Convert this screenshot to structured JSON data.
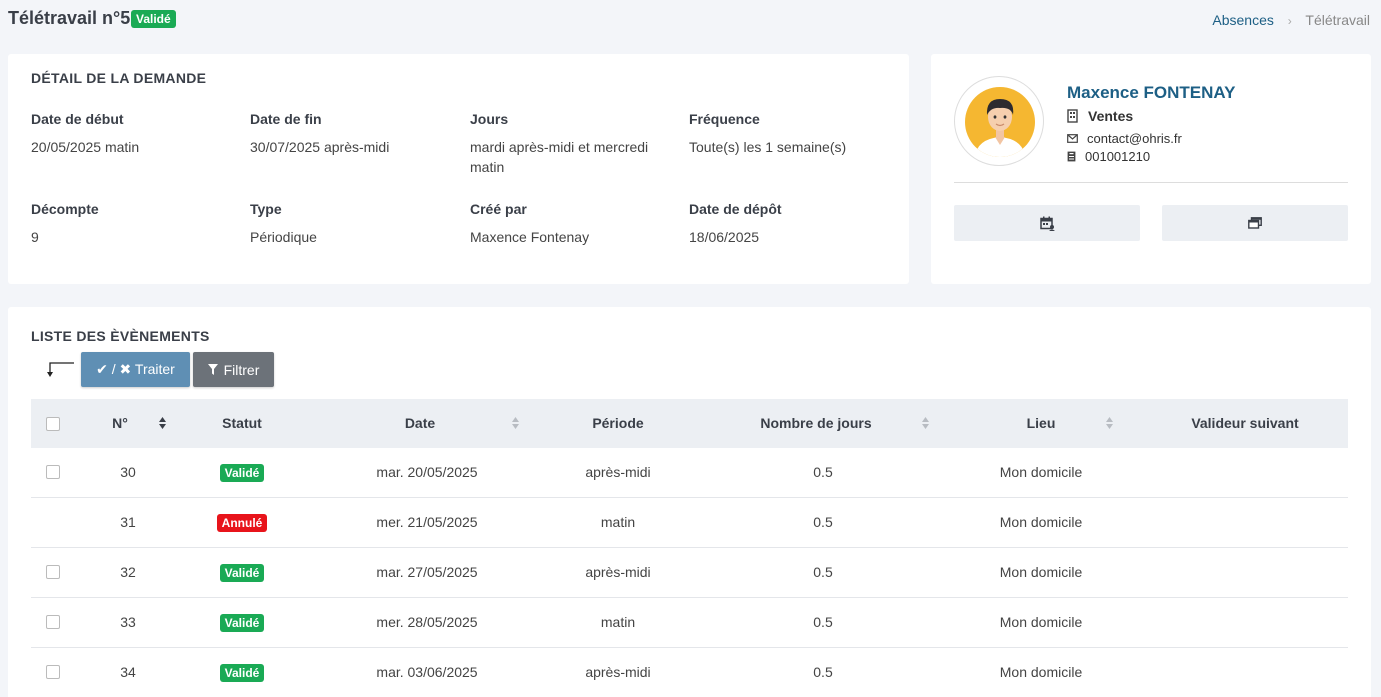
{
  "header": {
    "title": "Télétravail n°5",
    "status_badge": "Validé",
    "breadcrumb": {
      "parent": "Absences",
      "separator": "›",
      "current": "Télétravail"
    }
  },
  "detail": {
    "section_title": "DÉTAIL DE LA DEMANDE",
    "fields": [
      {
        "label": "Date de début",
        "value": "20/05/2025 matin"
      },
      {
        "label": "Date de fin",
        "value": "30/07/2025 après-midi"
      },
      {
        "label": "Jours",
        "value": "mardi après-midi et mercredi matin"
      },
      {
        "label": "Fréquence",
        "value": "Toute(s) les 1 semaine(s)"
      },
      {
        "label": "Décompte",
        "value": "9"
      },
      {
        "label": "Type",
        "value": "Périodique"
      },
      {
        "label": "Créé par",
        "value": "Maxence Fontenay"
      },
      {
        "label": "Date de dépôt",
        "value": "18/06/2025"
      }
    ]
  },
  "profile": {
    "name": "Maxence FONTENAY",
    "department": "Ventes",
    "email": "contact@ohris.fr",
    "employee_id": "001001210",
    "icons": {
      "department": "building-icon",
      "email": "envelope-icon",
      "id": "id-badge-icon",
      "btn1": "calendar-user-icon",
      "btn2": "windows-icon"
    }
  },
  "events": {
    "section_title": "LISTE DES ÈVÈNEMENTS",
    "actions": {
      "traiter_label": "✔ / ✖ Traiter",
      "filtrer_label": "Filtrer"
    },
    "columns": [
      "N°",
      "Statut",
      "Date",
      "Période",
      "Nombre de jours",
      "Lieu",
      "Valideur suivant"
    ],
    "rows": [
      {
        "num": "30",
        "status": "Validé",
        "status_color": "#1aaa55",
        "date": "mar. 20/05/2025",
        "period": "après-midi",
        "days": "0.5",
        "place": "Mon domicile",
        "next_validator": "",
        "selectable": true
      },
      {
        "num": "31",
        "status": "Annulé",
        "status_color": "#e8141b",
        "date": "mer. 21/05/2025",
        "period": "matin",
        "days": "0.5",
        "place": "Mon domicile",
        "next_validator": "",
        "selectable": false
      },
      {
        "num": "32",
        "status": "Validé",
        "status_color": "#1aaa55",
        "date": "mar. 27/05/2025",
        "period": "après-midi",
        "days": "0.5",
        "place": "Mon domicile",
        "next_validator": "",
        "selectable": true
      },
      {
        "num": "33",
        "status": "Validé",
        "status_color": "#1aaa55",
        "date": "mer. 28/05/2025",
        "period": "matin",
        "days": "0.5",
        "place": "Mon domicile",
        "next_validator": "",
        "selectable": true
      },
      {
        "num": "34",
        "status": "Validé",
        "status_color": "#1aaa55",
        "date": "mar. 03/06/2025",
        "period": "après-midi",
        "days": "0.5",
        "place": "Mon domicile",
        "next_validator": "",
        "selectable": true
      }
    ]
  },
  "colors": {
    "brand": "#1d5f85",
    "validated": "#1aaa55",
    "cancelled": "#e8141b",
    "traiter_button": "#5f8fb4",
    "filtrer_button": "#6c7279"
  }
}
